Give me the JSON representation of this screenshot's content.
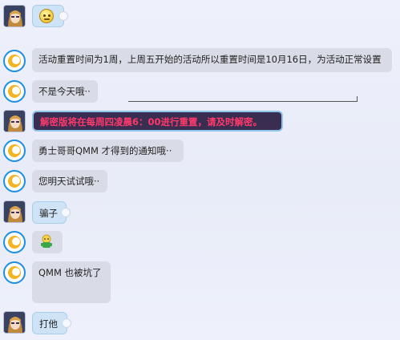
{
  "messages": [
    {
      "id": "m1",
      "sender": "girl",
      "type": "emoji",
      "emoji": "confused-face-emoji"
    },
    {
      "id": "m2",
      "sender": "qq",
      "type": "text",
      "text": "活动重置时间为1周，上周五开始的活动所以重置时间是10月16日，为活动正常设置"
    },
    {
      "id": "m3",
      "sender": "qq",
      "type": "text",
      "text": "不是今天哦··"
    },
    {
      "id": "m4",
      "sender": "girl",
      "type": "highlight",
      "text": "解密版将在每周四凌晨6：00进行重置，请及时解密。"
    },
    {
      "id": "m5",
      "sender": "qq",
      "type": "text",
      "text": "勇士哥哥QMM 才得到的通知哦··"
    },
    {
      "id": "m6",
      "sender": "qq",
      "type": "text",
      "text": "您明天试试哦··"
    },
    {
      "id": "m7",
      "sender": "girl",
      "type": "text",
      "text": "骗子"
    },
    {
      "id": "m8",
      "sender": "qq",
      "type": "emoji",
      "emoji": "green-doll-emoji"
    },
    {
      "id": "m9",
      "sender": "qq",
      "type": "text",
      "text": "QMM 也被坑了"
    },
    {
      "id": "m10",
      "sender": "girl",
      "type": "text",
      "text": "打他"
    }
  ],
  "colors": {
    "highlight_text": "#ff3a6b",
    "highlight_bg": "#3a2d52",
    "user_bubble": "#cfe3f6",
    "agent_bubble": "#d9dce6"
  }
}
